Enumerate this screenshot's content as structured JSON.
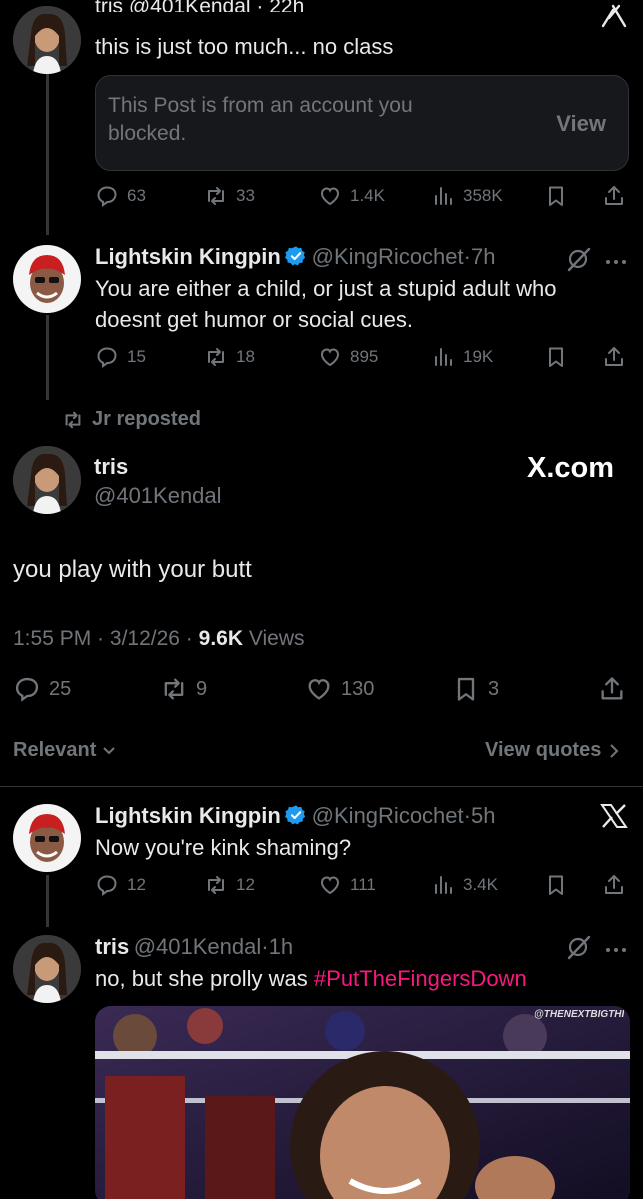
{
  "thread": {
    "post1": {
      "header": "tris @401Kendal · 22h",
      "text": "this is just too much... no class",
      "blocked_text": "This Post is from an account you blocked.",
      "view_label": "View",
      "replies": "63",
      "reposts": "33",
      "likes": "1.4K",
      "views": "358K"
    },
    "post2": {
      "name": "Lightskin Kingpin",
      "handle": "@KingRicochet",
      "time": "7h",
      "text": "You are either a child, or just a stupid adult who doesnt get humor or social cues.",
      "replies": "15",
      "reposts": "18",
      "likes": "895",
      "views": "19K"
    }
  },
  "main_post": {
    "reposted_by": "Jr reposted",
    "name": "tris",
    "handle": "@401Kendal",
    "watermark": "X.com",
    "text": "you play with your butt",
    "time": "1:55 PM",
    "date": "3/12/26",
    "views_count": "9.6K",
    "views_label": "Views",
    "replies": "25",
    "reposts": "9",
    "likes": "130",
    "bookmarks": "3"
  },
  "sort": {
    "label": "Relevant",
    "view_quotes": "View quotes"
  },
  "replies": [
    {
      "name": "Lightskin Kingpin",
      "handle": "@KingRicochet",
      "time": "5h",
      "text": "Now you're kink shaming?",
      "replies": "12",
      "reposts": "12",
      "likes": "111",
      "views": "3.4K"
    },
    {
      "name": "tris",
      "handle": "@401Kendal",
      "time": "1h",
      "text_plain": "no, but she prolly was ",
      "hashtag": "#PutTheFingersDown",
      "media_watermark": "@THENEXTBIGTHI..."
    }
  ],
  "colors": {
    "background": "#000000",
    "text": "#e7e9ea",
    "secondary": "#71767b",
    "verified": "#1d9bf0",
    "hashtag": "#f91880",
    "divider": "#2f3336"
  }
}
